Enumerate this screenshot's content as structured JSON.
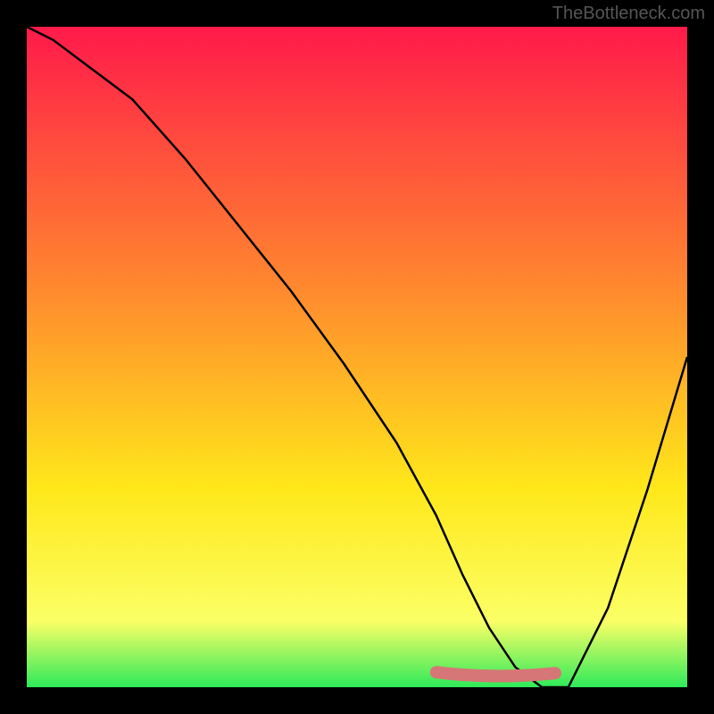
{
  "watermark": "TheBottleneck.com",
  "chart_data": {
    "type": "line",
    "title": "",
    "xlabel": "",
    "ylabel": "",
    "xlim": [
      0,
      100
    ],
    "ylim": [
      0,
      100
    ],
    "legend": false,
    "grid": false,
    "background_gradient": {
      "stops": [
        {
          "offset": 0,
          "color": "#ff1a4a"
        },
        {
          "offset": 40,
          "color": "#ff8a2e"
        },
        {
          "offset": 70,
          "color": "#ffe81a"
        },
        {
          "offset": 90,
          "color": "#fbff66"
        },
        {
          "offset": 100,
          "color": "#2eea5a"
        }
      ]
    },
    "series": [
      {
        "name": "bottleneck-curve",
        "x": [
          0,
          4,
          8,
          16,
          24,
          32,
          40,
          48,
          56,
          62,
          66,
          70,
          74,
          78,
          82,
          88,
          94,
          100
        ],
        "values": [
          100,
          98,
          95,
          89,
          80,
          70,
          60,
          49,
          37,
          26,
          17,
          9,
          3,
          0,
          0,
          12,
          30,
          50
        ]
      }
    ],
    "annotation": {
      "name": "optimal-band",
      "x_start": 62,
      "x_end": 80,
      "y": 2,
      "color": "#d67676"
    }
  }
}
